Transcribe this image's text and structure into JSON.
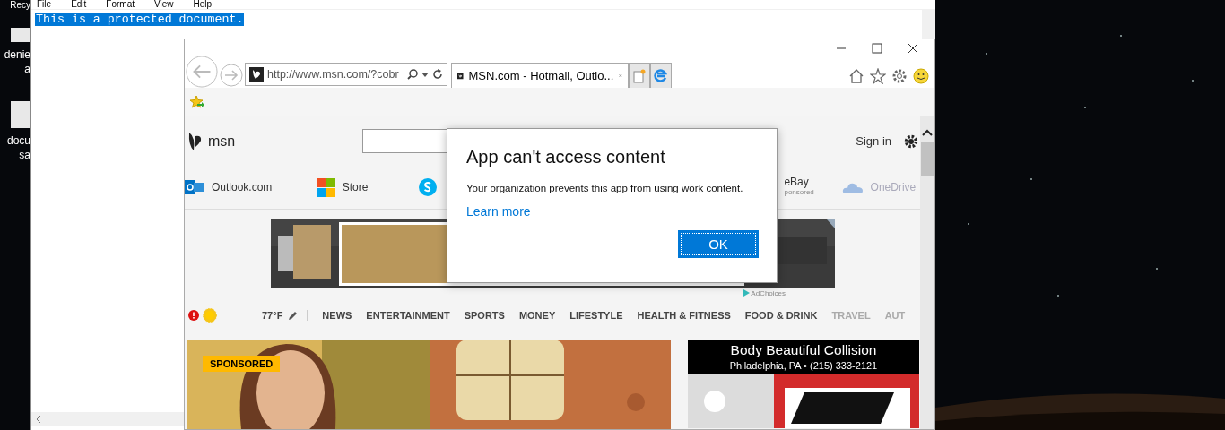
{
  "desktop": {
    "icons": [
      {
        "lines": [
          "Recy"
        ],
        "thumb": false
      },
      {
        "lines": [
          "denie",
          "a"
        ],
        "thumb": true
      },
      {
        "lines": [
          "docu",
          "sa"
        ],
        "thumb": true
      }
    ]
  },
  "notepad": {
    "menu": [
      "File",
      "Edit",
      "Format",
      "View",
      "Help"
    ],
    "text": "This is a protected document.",
    "selected": true
  },
  "browser": {
    "address": "http://www.msn.com/?cobr",
    "tabs": [
      {
        "title": "MSN.com - Hotmail, Outlo...",
        "selected": true
      }
    ]
  },
  "page": {
    "logo": "msn",
    "sign_in": "Sign in",
    "links": [
      {
        "kind": "outlook",
        "label": "Outlook.com",
        "faded": false
      },
      {
        "kind": "store",
        "label": "Store",
        "faded": false
      },
      {
        "kind": "skype",
        "faded": false
      },
      {
        "kind": "ebay",
        "label": "eBay",
        "sublabel": "ponsored",
        "faded": false
      },
      {
        "kind": "onedrive",
        "label": "OneDrive",
        "faded": true
      }
    ],
    "ad": {
      "kind": "picture",
      "adchoices": "AdChoices"
    },
    "nav": {
      "weather": "77°F",
      "items": [
        {
          "label": "NEWS",
          "faded": false
        },
        {
          "label": "ENTERTAINMENT",
          "faded": false
        },
        {
          "label": "SPORTS",
          "faded": false
        },
        {
          "label": "MONEY",
          "faded": false
        },
        {
          "label": "LIFESTYLE",
          "faded": false
        },
        {
          "label": "HEALTH & FITNESS",
          "faded": false
        },
        {
          "label": "FOOD & DRINK",
          "faded": false
        },
        {
          "label": "TRAVEL",
          "faded": true
        },
        {
          "label": "AUT",
          "faded": true
        }
      ]
    },
    "card": {
      "badge": "SPONSORED"
    },
    "side_ad": {
      "title": "Body Beautiful Collision",
      "subtitle": "Philadelphia, PA • (215) 333-2121"
    }
  },
  "dialog": {
    "title": "App can't access content",
    "message": "Your organization prevents this app from using work content.",
    "link": "Learn more",
    "button": "OK"
  }
}
